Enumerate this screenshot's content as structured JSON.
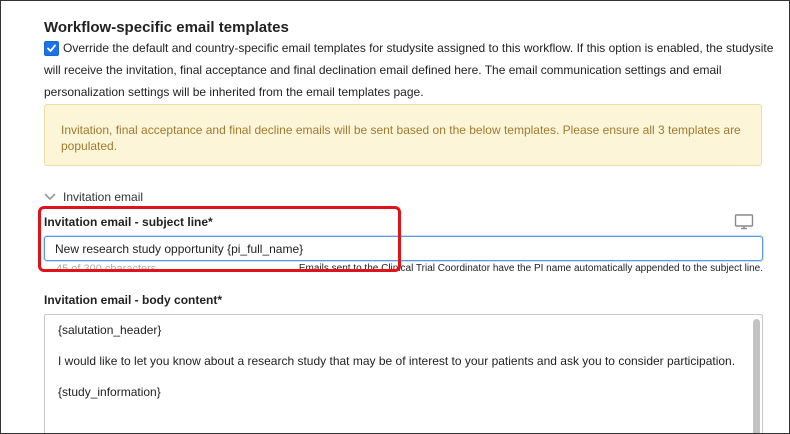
{
  "section": {
    "title": "Workflow-specific email templates",
    "override_checked": true,
    "override_text": "Override the default and country-specific email templates for studysite assigned to this workflow. If this option is enabled, the studysite will receive the invitation, final acceptance and final declination email defined here. The email communication settings and email personalization settings will be inherited from the email templates page."
  },
  "notice": {
    "text": "Invitation, final acceptance and final decline emails will be sent based on the below templates. Please ensure all 3 templates are populated."
  },
  "accordion": {
    "label": "Invitation email",
    "expanded": true
  },
  "subject": {
    "label": "Invitation email - subject line*",
    "value": "New research study opportunity {pi_full_name}",
    "char_count": "45 of 300 characters",
    "note": "Emails sent to the Clinical Trial Coordinator have the PI name automatically appended to the subject line."
  },
  "body": {
    "label": "Invitation email - body content*",
    "paragraphs": [
      "{salutation_header}",
      "I would like to let you know about a research study that may be of interest to your patients and ask you to consider participation.",
      "{study_information}"
    ]
  },
  "icons": {
    "preview": "monitor-icon",
    "accordion": "chevron-down-icon",
    "checkbox": "checkmark-icon"
  },
  "colors": {
    "accent": "#1a73e8",
    "notice_bg": "#fdf5d8",
    "notice_text": "#a07a2e",
    "highlight": "#e0121a"
  }
}
